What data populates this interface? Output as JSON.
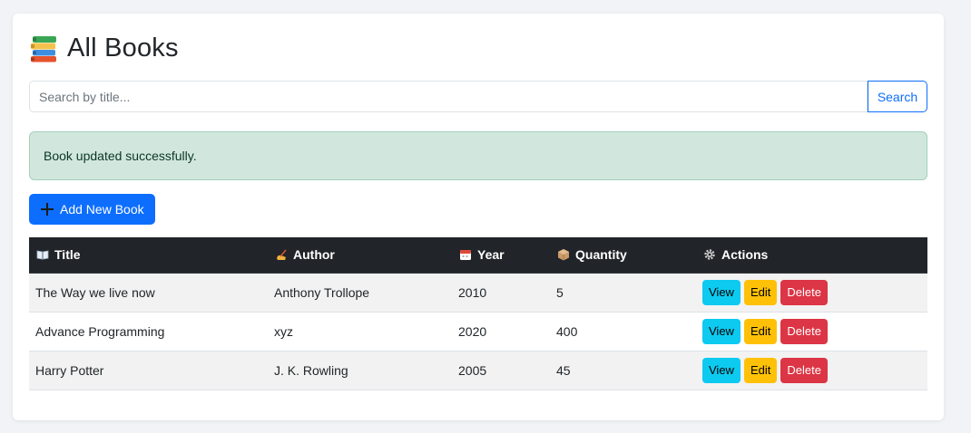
{
  "page": {
    "title": "All Books",
    "icon": "books-stack-icon"
  },
  "search": {
    "placeholder": "Search by title...",
    "value": "",
    "button_label": "Search"
  },
  "alert": {
    "message": "Book updated successfully."
  },
  "add_button": {
    "label": "Add New Book",
    "icon": "plus-icon"
  },
  "table": {
    "headers": [
      {
        "label": "Title",
        "icon": "open-book-icon"
      },
      {
        "label": "Author",
        "icon": "writing-hand-icon"
      },
      {
        "label": "Year",
        "icon": "calendar-icon"
      },
      {
        "label": "Quantity",
        "icon": "package-icon"
      },
      {
        "label": "Actions",
        "icon": "gear-icon"
      }
    ],
    "rows": [
      {
        "title": "The Way we live now",
        "author": "Anthony Trollope",
        "year": "2010",
        "quantity": "5"
      },
      {
        "title": "Advance Programming",
        "author": "xyz",
        "year": "2020",
        "quantity": "400"
      },
      {
        "title": "Harry Potter",
        "author": "J. K. Rowling",
        "year": "2005",
        "quantity": "45"
      }
    ],
    "actions": {
      "view": "View",
      "edit": "Edit",
      "delete": "Delete"
    }
  },
  "colors": {
    "primary": "#0d6efd",
    "info": "#0dcaf0",
    "warning": "#ffc107",
    "danger": "#dc3545",
    "success_bg": "#d1e7dd",
    "header_dark": "#212529"
  }
}
